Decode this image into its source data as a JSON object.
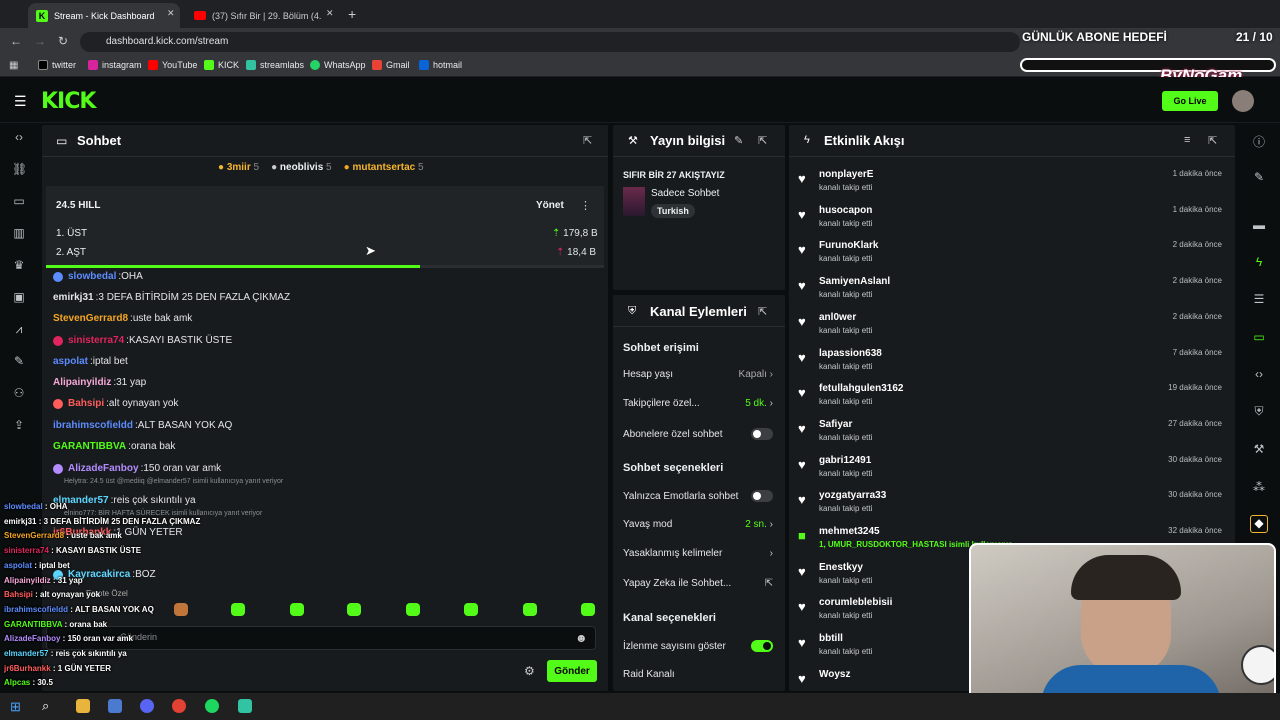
{
  "browser": {
    "tabs": [
      {
        "title": "Stream - Kick Dashboard"
      },
      {
        "title": "(37) Sıfır Bir | 29. Bölüm (4. SE..."
      }
    ],
    "url": "dashboard.kick.com/stream",
    "bookmarks": [
      "twitter",
      "instagram",
      "YouTube",
      "KICK",
      "streamlabs",
      "WhatsApp",
      "Gmail",
      "hotmail"
    ]
  },
  "overlay": {
    "goal_label": "GÜNLÜK ABONE HEDEFİ",
    "goal_value": "21 / 10",
    "brand": "ByNoGam"
  },
  "header": {
    "logo": "KICK",
    "go_live": "Go Live"
  },
  "chat": {
    "title": "Sohbet",
    "top_supporters": [
      {
        "name": "3miir",
        "count": "5",
        "color": "#f5b52c"
      },
      {
        "name": "neoblivis",
        "count": "5",
        "color": "#e4e6e7"
      },
      {
        "name": "mutantsertac",
        "count": "5",
        "color": "#f5b52c"
      }
    ],
    "prediction": {
      "title": "24.5 HILL",
      "manage": "Yönet",
      "options": [
        {
          "label": "1. ÜST",
          "value": "179,8 B"
        },
        {
          "label": "2. AŞT",
          "value": "18,4 B"
        }
      ],
      "progress": 0.67
    },
    "messages": [
      {
        "user": "slowbedal",
        "text": "OHA",
        "color": "#5c8cff"
      },
      {
        "user": "emirkj31",
        "text": "3 DEFA BİTİRDİM 25 DEN FAZLA ÇIKMAZ",
        "color": "#e4e6e7"
      },
      {
        "user": "StevenGerrard8",
        "text": "uste bak amk",
        "color": "#f5a623"
      },
      {
        "user": "sinisterra74",
        "text": "KASAYI BASTIK ÜSTE",
        "color": "#e0245e"
      },
      {
        "user": "aspolat",
        "text": "iptal bet",
        "color": "#5c8cff"
      },
      {
        "user": "Alipainyildiz",
        "text": "31 yap",
        "color": "#f7a8d8"
      },
      {
        "user": "Bahsipi",
        "text": "alt oynayan yok",
        "color": "#ff5c5c"
      },
      {
        "user": "ibrahimscofieldd",
        "text": "ALT BASAN YOK AQ",
        "color": "#5c8cff"
      },
      {
        "user": "GARANTIBBVA",
        "text": "orana bak",
        "color": "#53fc18"
      },
      {
        "user": "AlizadeFanboy",
        "text": "150 oran var amk",
        "color": "#b48cff"
      },
      {
        "user": "elmander57",
        "text": "reis çok sıkıntılı ya",
        "color": "#5cd6ff"
      },
      {
        "user": "jr6Burhankk",
        "text": "1 GÜN YETER",
        "color": "#ff5c5c"
      },
      {
        "user": "Kayracakirca",
        "text": "BOZ",
        "color": "#5cd6ff"
      }
    ],
    "reply_notes": [
      "Helytra: 24.5 üst @mediiq @elmander57 isimli kullanıcıya yanıt veriyor",
      "elnino777: BİR HAFTA SÜRECEK isimli kullanıcıya yanıt veriyor"
    ],
    "emote_label": "Emote Özel",
    "input_placeholder": "Gönderin",
    "send": "Gönder"
  },
  "stream_info": {
    "title": "Yayın bilgisi",
    "stream_title": "SIFIR BİR 27 AKIŞTAYIZ",
    "category": "Sadece Sohbet",
    "tag": "Turkish"
  },
  "channel_actions": {
    "title": "Kanal Eylemleri",
    "section1": "Sohbet erişimi",
    "rows1": [
      {
        "label": "Hesap yaşı",
        "value": "Kapalı"
      },
      {
        "label": "Takipçilere özel...",
        "value": "5 dk."
      },
      {
        "label": "Abonelere özel sohbet",
        "value": ""
      }
    ],
    "section2": "Sohbet seçenekleri",
    "rows2": [
      {
        "label": "Yalnızca Emotlarla sohbet",
        "value": ""
      },
      {
        "label": "Yavaş mod",
        "value": "2 sn."
      },
      {
        "label": "Yasaklanmış kelimeler",
        "value": ""
      },
      {
        "label": "Yapay Zeka ile Sohbet...",
        "value": ""
      }
    ],
    "section3": "Kanal seçenekleri",
    "rows3": [
      {
        "label": "İzlenme sayısını göster",
        "value": ""
      },
      {
        "label": "Raid Kanalı",
        "value": ""
      }
    ]
  },
  "activity": {
    "title": "Etkinlik Akışı",
    "items": [
      {
        "name": "nonplayerE",
        "sub": "kanalı takip etti",
        "time": "1 dakika önce"
      },
      {
        "name": "husocapon",
        "sub": "kanalı takip etti",
        "time": "1 dakika önce"
      },
      {
        "name": "FurunoKlark",
        "sub": "kanalı takip etti",
        "time": "2 dakika önce"
      },
      {
        "name": "SamiyenAslanl",
        "sub": "kanalı takip etti",
        "time": "2 dakika önce"
      },
      {
        "name": "anl0wer",
        "sub": "kanalı takip etti",
        "time": "2 dakika önce"
      },
      {
        "name": "lapassion638",
        "sub": "kanalı takip etti",
        "time": "7 dakika önce"
      },
      {
        "name": "fetullahgulen3162",
        "sub": "kanalı takip etti",
        "time": "19 dakika önce"
      },
      {
        "name": "Safiyar",
        "sub": "kanalı takip etti",
        "time": "27 dakika önce"
      },
      {
        "name": "gabri12491",
        "sub": "kanalı takip etti",
        "time": "30 dakika önce"
      },
      {
        "name": "yozgatyarra33",
        "sub": "kanalı takip etti",
        "time": "30 dakika önce"
      },
      {
        "name": "mehmet3245",
        "sub": "1, UMUR_RUSDOKTOR_HASTASI isimli kullanıcıya",
        "time": "32 dakika önce"
      },
      {
        "name": "Enestkyy",
        "sub": "kanalı takip etti",
        "time": ""
      },
      {
        "name": "corumleblebisii",
        "sub": "kanalı takip etti",
        "time": ""
      },
      {
        "name": "bbtill",
        "sub": "kanalı takip etti",
        "time": ""
      },
      {
        "name": "Woysz",
        "sub": "",
        "time": ""
      }
    ]
  },
  "overlay_chat": [
    {
      "user": "slowbedal",
      "text": "OHA",
      "color": "#5c8cff"
    },
    {
      "user": "emirkj31",
      "text": "3 DEFA BİTİRDİM 25 DEN FAZLA ÇIKMAZ",
      "color": "#ffffff"
    },
    {
      "user": "StevenGerrard8",
      "text": "uste bak amk",
      "color": "#f5a623"
    },
    {
      "user": "sinisterra74",
      "text": "KASAYI BASTIK ÜSTE",
      "color": "#e0245e"
    },
    {
      "user": "aspolat",
      "text": "iptal bet",
      "color": "#5c8cff"
    },
    {
      "user": "Alipainyildiz",
      "text": "31 yap",
      "color": "#f7a8d8"
    },
    {
      "user": "Bahsipi",
      "text": "alt oynayan yok",
      "color": "#ff5c5c"
    },
    {
      "user": "ibrahimscofieldd",
      "text": "ALT BASAN YOK AQ",
      "color": "#5c8cff"
    },
    {
      "user": "GARANTIBBVA",
      "text": "orana bak",
      "color": "#53fc18"
    },
    {
      "user": "AlizadeFanboy",
      "text": "150 oran var amk",
      "color": "#b48cff"
    },
    {
      "user": "elmander57",
      "text": "reis çok sıkıntılı ya",
      "color": "#5cd6ff"
    },
    {
      "user": "jr6Burhankk",
      "text": "1 GÜN YETER",
      "color": "#ff5c5c"
    },
    {
      "user": "Alpcas",
      "text": "30.5",
      "color": "#53fc18"
    }
  ],
  "colors": {
    "accent": "#53fc18",
    "panel": "#181b1d",
    "bg": "#0b0e0f"
  }
}
